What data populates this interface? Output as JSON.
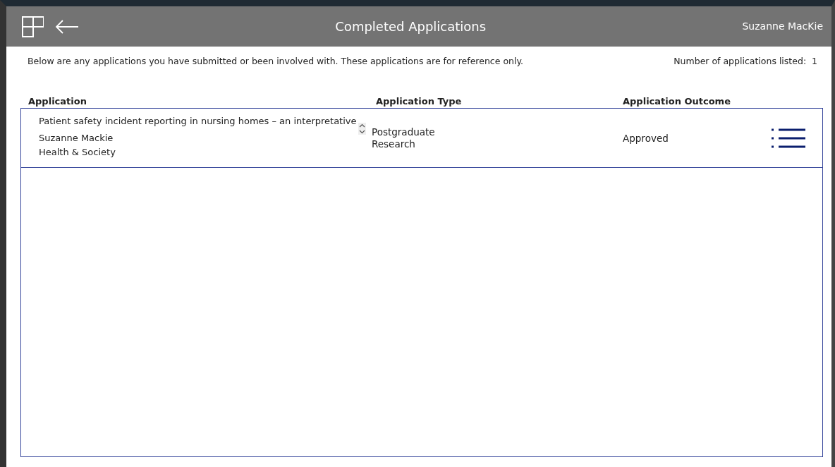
{
  "header": {
    "title": "Completed Applications",
    "user": "Suzanne MacKie"
  },
  "intro": "Below are any applications you have submitted or been involved with. These applications are for reference only.",
  "count_label": "Number of applications listed:",
  "count": "1",
  "table": {
    "columns": [
      "Application",
      "Application Type",
      "Application Outcome"
    ],
    "rows": [
      {
        "title": "Patient safety incident reporting in nursing homes – an interpretative",
        "applicant": "Suzanne Mackie",
        "school": "Health & Society",
        "type": "Postgraduate Research",
        "outcome": "Approved"
      }
    ]
  }
}
